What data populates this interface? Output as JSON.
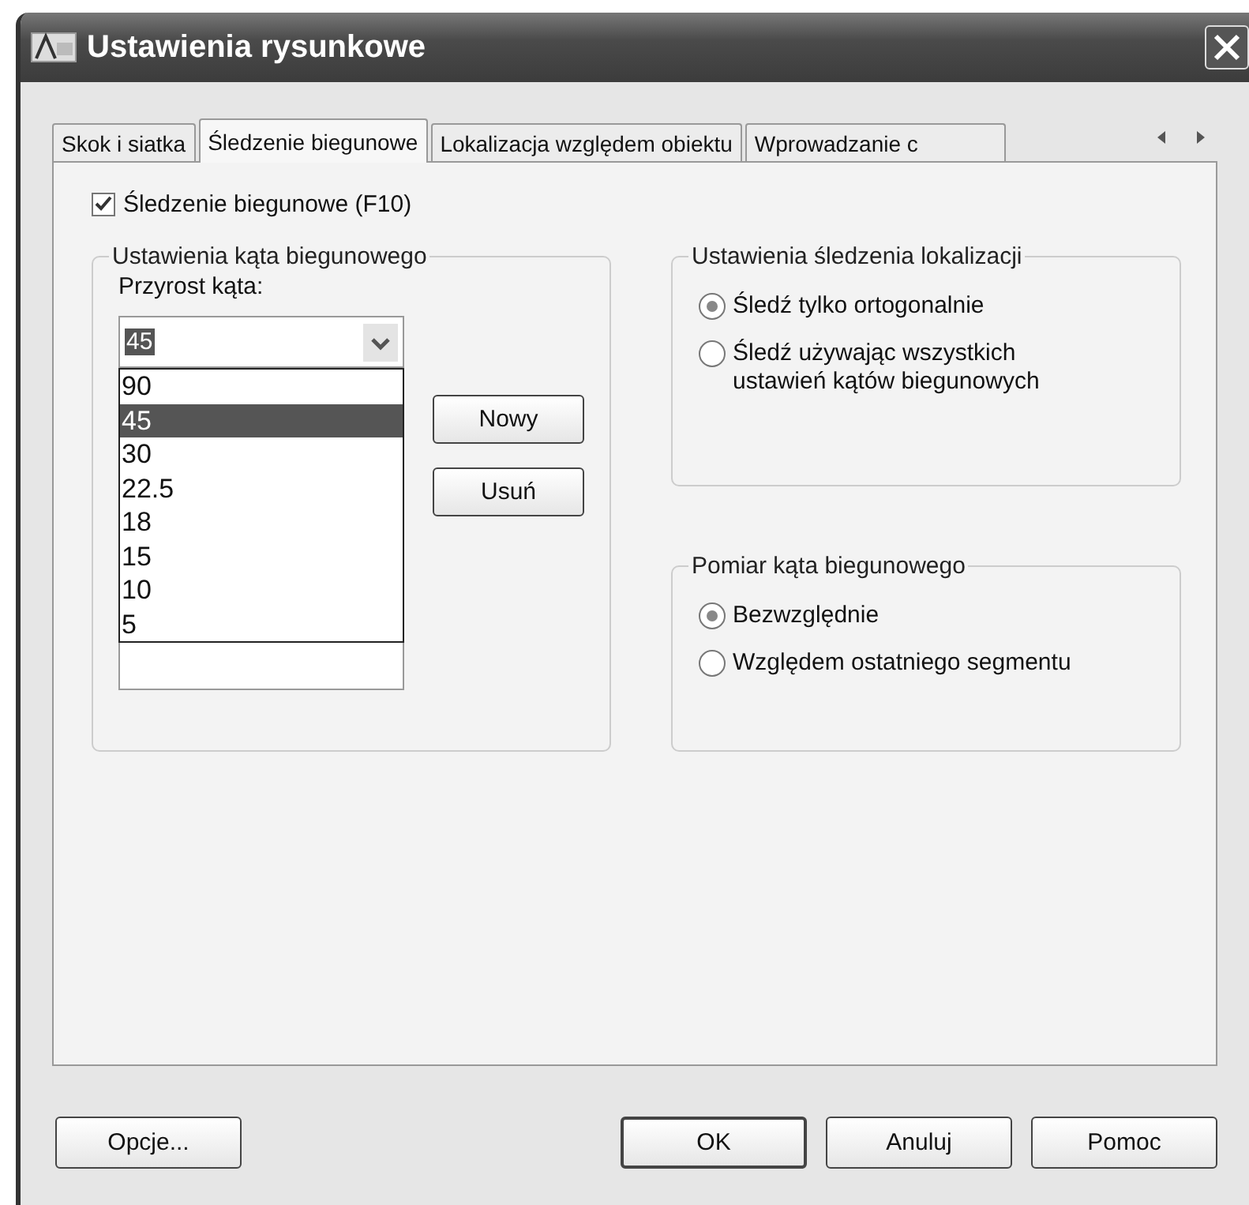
{
  "window": {
    "title": "Ustawienia rysunkowe"
  },
  "tabs": [
    {
      "label": "Skok i siatka",
      "selected": false
    },
    {
      "label": "Śledzenie biegunowe",
      "selected": true
    },
    {
      "label": "Lokalizacja względem obiektu",
      "selected": false
    },
    {
      "label": "Wprowadzanie c",
      "selected": false
    }
  ],
  "polar_tracking": {
    "label": "Śledzenie biegunowe (F10)",
    "checked": true
  },
  "angle_group": {
    "title": "Ustawienia kąta biegunowego",
    "increment_label": "Przyrost kąta:",
    "combo": {
      "value": "45",
      "expanded": true
    },
    "options": [
      {
        "label": "90",
        "selected": false
      },
      {
        "label": "45",
        "selected": true
      },
      {
        "label": "30",
        "selected": false
      },
      {
        "label": "22.5",
        "selected": false
      },
      {
        "label": "18",
        "selected": false
      },
      {
        "label": "15",
        "selected": false
      },
      {
        "label": "10",
        "selected": false
      },
      {
        "label": "5",
        "selected": false
      }
    ],
    "buttons": [
      "Nowy",
      "Usuń"
    ]
  },
  "tracking_group": {
    "title": "Ustawienia śledzenia lokalizacji",
    "options": [
      {
        "label": "Śledź tylko ortogonalnie",
        "selected": true
      },
      {
        "label": "Śledź używając wszystkich ustawień kątów biegunowych",
        "selected": false
      }
    ]
  },
  "measure_group": {
    "title": "Pomiar kąta biegunowego",
    "options": [
      {
        "label": "Bezwzględnie",
        "selected": true
      },
      {
        "label": "Względem ostatniego segmentu",
        "selected": false
      }
    ]
  },
  "footer": {
    "left_button": "Opcje...",
    "buttons": [
      {
        "label": "OK",
        "default": true
      },
      {
        "label": "Anuluj",
        "default": false
      },
      {
        "label": "Pomoc",
        "default": false
      }
    ]
  }
}
